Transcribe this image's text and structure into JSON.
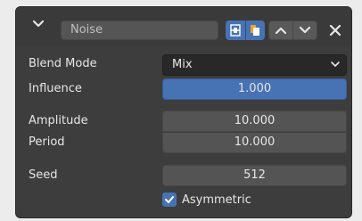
{
  "header": {
    "name_value": "Noise",
    "icons": {
      "collapse": "chevron-down-icon",
      "filter_toggle": "edit-mode-icon",
      "copy_toggle": "copy-document-icon",
      "move_up": "triangle-up-icon",
      "move_down": "triangle-down-icon",
      "close": "close-icon"
    }
  },
  "properties": {
    "blend_mode": {
      "label": "Blend Mode",
      "value": "Mix"
    },
    "influence": {
      "label": "Influence",
      "value": "1.000",
      "fraction": 1.0
    },
    "amplitude": {
      "label": "Amplitude",
      "value": "10.000"
    },
    "period": {
      "label": "Period",
      "value": "10.000"
    },
    "seed": {
      "label": "Seed",
      "value": "512"
    },
    "asymmetric": {
      "label": "Asymmetric",
      "checked": true
    }
  },
  "colors": {
    "panel_bg": "#3d3d3d",
    "accent": "#4772b3",
    "field_bg": "#545454",
    "text": "#e6e6e6"
  }
}
